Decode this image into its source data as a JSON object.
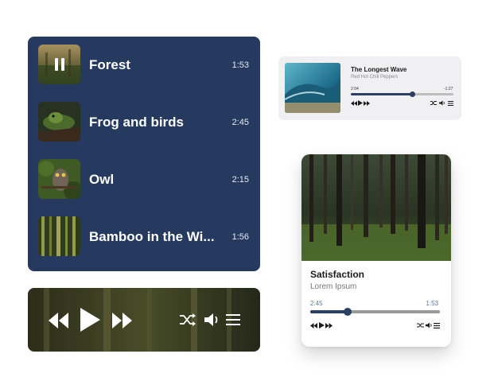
{
  "playlist": {
    "items": [
      {
        "title": "Forest",
        "duration": "1:53",
        "state": "playing",
        "thumb": "forest-thumbnail"
      },
      {
        "title": "Frog and birds",
        "duration": "2:45",
        "thumb": "frog-thumbnail"
      },
      {
        "title": "Owl",
        "duration": "2:15",
        "thumb": "owl-thumbnail"
      },
      {
        "title": "Bamboo in the Wi...",
        "duration": "1:56",
        "thumb": "bamboo-thumbnail"
      }
    ]
  },
  "control_bar": {
    "icons": [
      "rewind-icon",
      "play-icon",
      "fast-forward-icon",
      "shuffle-icon",
      "volume-icon",
      "menu-icon"
    ]
  },
  "mini_player": {
    "song": "The Longest Wave",
    "artist": "Red Hot Chili Peppers",
    "elapsed": "2:04",
    "remaining": "-1:27",
    "progress": 0.6
  },
  "card_player": {
    "song": "Satisfaction",
    "artist": "Lorem Ipsum",
    "elapsed": "2:45",
    "remaining": "1:53",
    "progress": 0.29
  },
  "colors": {
    "panel": "#253a5e",
    "accent": "#2b3f63",
    "time_text": "#5b74a3"
  }
}
